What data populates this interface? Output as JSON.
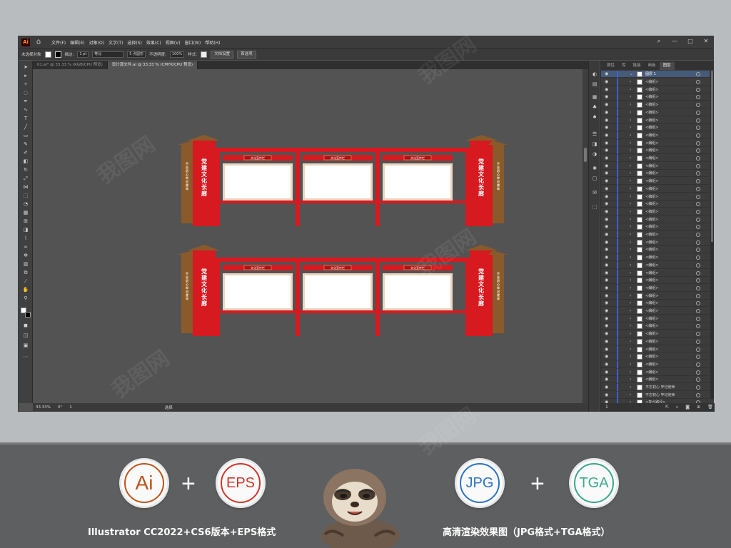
{
  "app": {
    "logo": "Ai",
    "menus": [
      "文件(F)",
      "编辑(E)",
      "对象(O)",
      "文字(T)",
      "选择(S)",
      "效果(C)",
      "视图(V)",
      "窗口(W)",
      "帮助(H)"
    ],
    "window_controls": [
      "—",
      "□",
      "✕"
    ]
  },
  "control_bar": {
    "selection_label": "未选择对象",
    "stroke_label": "描边:",
    "stroke_value": "1 pt",
    "stroke_style": "等比",
    "brush_value": "5 点圆形",
    "opacity_label": "不透明度:",
    "opacity_value": "100%",
    "style_label": "样式:",
    "doc_setup_button": "文档设置",
    "prefs_button": "首选项"
  },
  "doc_tabs": [
    {
      "label": "01.ai* @ 33.33 % (RGB/CPU 预览)",
      "active": false
    },
    {
      "label": "设计源文件.ai @ 33.33 % (CMYK/CPU 预览)",
      "active": true
    }
  ],
  "status_bar": {
    "zoom": "33.33%",
    "rotation": "0°",
    "page": "1",
    "tool": "选择"
  },
  "layers_panel": {
    "tabs": [
      "属性",
      "库",
      "链接",
      "画板",
      "图层"
    ],
    "active_tab": "图层",
    "top_layer": "图层 1",
    "rows": [
      "<编组>",
      "<编组>",
      "<编组>",
      "<编组>",
      "<编组>",
      "<编组>",
      "<编组>",
      "<编组>",
      "<编组>",
      "<编组>",
      "<编组>",
      "<编组>",
      "<编组>",
      "<编组>",
      "<编组>",
      "<编组>",
      "<编组>",
      "<编组>",
      "<编组>",
      "<编组>",
      "<编组>",
      "<编组>",
      "<编组>",
      "<编组>",
      "<编组>",
      "<编组>",
      "<编组>",
      "<编组>",
      "<编组>",
      "<编组>",
      "<编组>",
      "<编组>",
      "<编组>",
      "<编组>",
      "<编组>",
      "<编组>",
      "<编组>",
      "<编组>",
      "<编组>",
      "<编组>",
      "不忘初心  牢记使命",
      "不忘初心  牢记使命",
      "<复合路径>"
    ]
  },
  "artwork": {
    "pillar_title": "党建文化长廊",
    "side_slogan": "不忘初心 牢记使命",
    "header_tag": "文化宣传栏",
    "colors": {
      "red": "#d71920",
      "brown": "#8a5a2b",
      "panel_border": "#e9d6c0"
    }
  },
  "footer": {
    "badges": [
      {
        "label": "Ai",
        "color": "#c0531a"
      },
      {
        "label": "EPS",
        "color": "#d2352b"
      },
      {
        "label": "JPG",
        "color": "#2b73c7"
      },
      {
        "label": "TGA",
        "color": "#3aa98a"
      }
    ],
    "plus": "+",
    "caption_left": "Illustrator CC2022+CS6版本+EPS格式",
    "caption_right": "高清渲染效果图（JPG格式+TGA格式）"
  },
  "watermark": "我图网"
}
